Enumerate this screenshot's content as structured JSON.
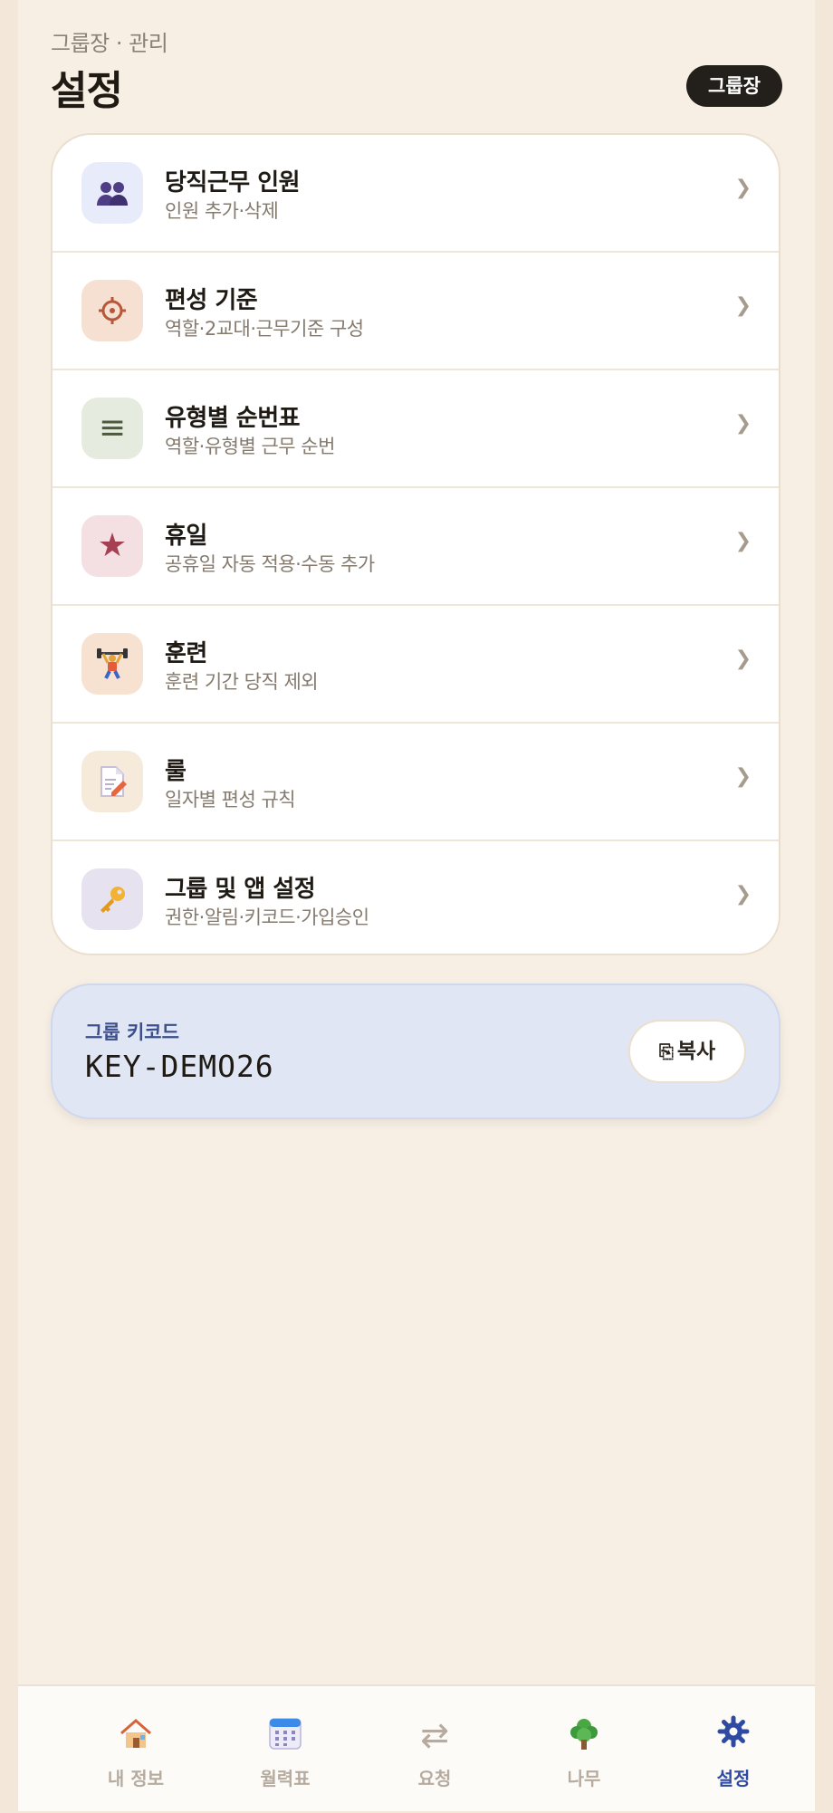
{
  "header": {
    "subtitle": "그룹장 · 관리",
    "title": "설정",
    "role_badge": "그룹장"
  },
  "menu": [
    {
      "icon": "people-icon",
      "glyph": "👥",
      "icon_bg": "#e8ecfa",
      "title": "당직근무 인원",
      "desc": "인원 추가·삭제"
    },
    {
      "icon": "gear-icon",
      "glyph": "⚙",
      "icon_bg": "#f6e0d2",
      "title": "편성 기준",
      "desc": "역할·2교대·근무기준 구성"
    },
    {
      "icon": "list-icon",
      "glyph": "≡",
      "icon_bg": "#e6ebdf",
      "title": "유형별 순번표",
      "desc": "역할·유형별 근무 순번"
    },
    {
      "icon": "star-icon",
      "glyph": "★",
      "icon_bg": "#f4dfe2",
      "title": "휴일",
      "desc": "공휴일 자동 적용·수동 추가"
    },
    {
      "icon": "weightlifter-icon",
      "glyph": "🏋",
      "icon_bg": "#f7e2d2",
      "title": "훈련",
      "desc": "훈련 기간 당직 제외"
    },
    {
      "icon": "memo-icon",
      "glyph": "📝",
      "icon_bg": "#f6eadb",
      "title": "룰",
      "desc": "일자별 편성 규칙"
    },
    {
      "icon": "key-icon",
      "glyph": "🔑",
      "icon_bg": "#e7e2f0",
      "title": "그룹 및 앱 설정",
      "desc": "권한·알림·키코드·가입승인"
    }
  ],
  "invite": {
    "label": "그룹 키코드",
    "code": "KEY-DEMO26",
    "copy_label": "복사",
    "copy_icon": "copy-icon"
  },
  "tabs": [
    {
      "icon": "home-icon",
      "glyph": "🏠",
      "label": "내 정보",
      "active": false
    },
    {
      "icon": "calendar-icon",
      "glyph": "📅",
      "label": "월력표",
      "active": false
    },
    {
      "icon": "swap-arrows-icon",
      "glyph": "⇄",
      "label": "요청",
      "active": false
    },
    {
      "icon": "tree-icon",
      "glyph": "🌳",
      "label": "나무",
      "active": false
    },
    {
      "icon": "gear-icon",
      "glyph": "⚙",
      "label": "설정",
      "active": true
    }
  ],
  "colors": {
    "accent": "#2f4aa3",
    "badge_bg": "#231f1a",
    "background": "#f7efe4"
  }
}
